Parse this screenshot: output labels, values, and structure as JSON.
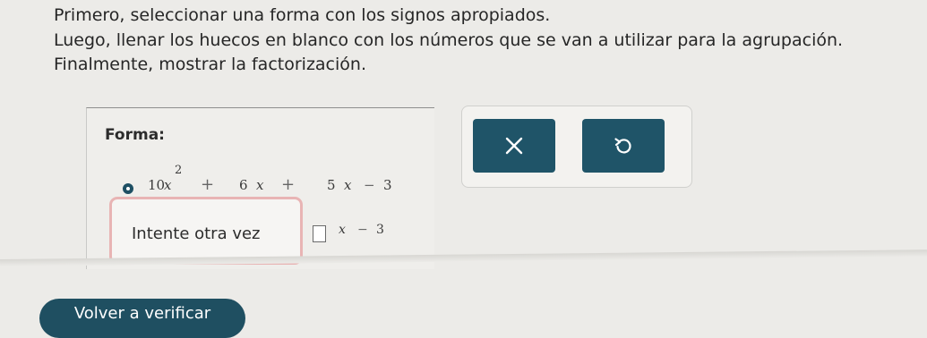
{
  "instructions": {
    "line1": "Primero, seleccionar una forma con los signos apropiados.",
    "line2": "Luego, llenar los huecos en blanco con los números que se van a utilizar para la agrupación.",
    "line3": "Finalmente, mostrar la factorización."
  },
  "work": {
    "forma_label": "Forma:",
    "expression": {
      "coef1": "10",
      "var1": "x",
      "exp1": "2",
      "op1": "+",
      "coef2": "6",
      "var2": "x",
      "op2": "+",
      "coef3": "5",
      "var3": "x",
      "op3": "−",
      "const": "3"
    },
    "feedback": "Intente otra vez",
    "factor_term": {
      "var": "x",
      "op": "−",
      "const": "3"
    }
  },
  "controls": {
    "clear_icon": "close-icon",
    "undo_icon": "undo-icon",
    "button_color": "#1f5468"
  },
  "footer": {
    "check_again_label": "Volver a verificar"
  }
}
